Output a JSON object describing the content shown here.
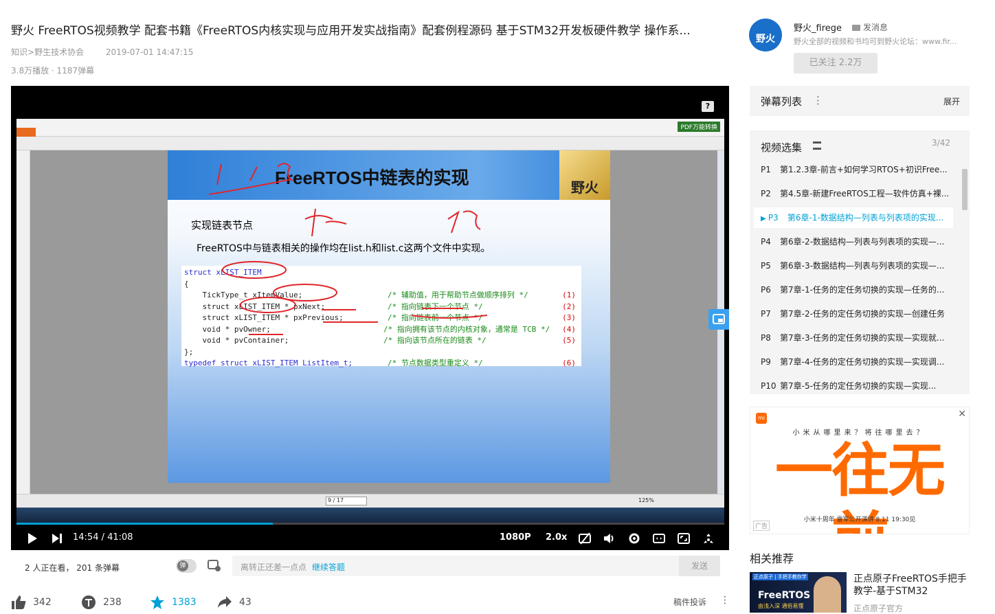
{
  "video": {
    "title": "野火 FreeRTOS视频教学 配套书籍《FreeRTOS内核实现与应用开发实战指南》配套例程源码 基于STM32开发板硬件教学 操作系...",
    "breadcrumb_1": "知识",
    "breadcrumb_sep": ">",
    "breadcrumb_2": "野生技术协会",
    "date": "2019-07-01 14:47:15",
    "stats": "3.8万播放 · 1187弹幕"
  },
  "player": {
    "time": "14:54 / 41:08",
    "quality": "1080P",
    "speed": "2.0x",
    "progress": 0.362,
    "watching": "2 人正在看， 201 条弹幕",
    "danmaku_placeholder": "离转正还差一点点",
    "danmaku_link": "继续答题",
    "send_label": "发送",
    "danmaku_knob": "弹"
  },
  "slide": {
    "title": "FreeRTOS中链表的实现",
    "logo": "野火",
    "heading": "实现链表节点",
    "desc": "FreeRTOS中与链表相关的操作均在list.h和list.c这两个文件中实现。",
    "code_lines": [
      {
        "text": "struct xLIST_ITEM",
        "comment": "",
        "num": ""
      },
      {
        "text": "{",
        "comment": "",
        "num": ""
      },
      {
        "text": "    TickType_t xItemValue;",
        "comment": "/* 辅助值，用于帮助节点做顺序排列 */",
        "num": "(1)"
      },
      {
        "text": "    struct xLIST_ITEM * pxNext;",
        "comment": "/* 指向链表下一个节点 */",
        "num": "(2)"
      },
      {
        "text": "    struct xLIST_ITEM * pxPrevious;",
        "comment": "/* 指向链表前一个节点 */",
        "num": "(3)"
      },
      {
        "text": "    void * pvOwner;",
        "comment": "/* 指向拥有该节点的内核对象，通常是 TCB */",
        "num": "(4)"
      },
      {
        "text": "    void * pvContainer;",
        "comment": "/* 指向该节点所在的链表 */",
        "num": "(5)"
      },
      {
        "text": "};",
        "comment": "",
        "num": ""
      },
      {
        "text": "typedef struct xLIST_ITEM ListItem_t;",
        "comment": "/* 节点数据类型重定义 */",
        "num": "(6)"
      }
    ],
    "pdf_button": "PDF万能转换",
    "page_indicator": "9 / 17",
    "zoom": "125%"
  },
  "uploader": {
    "name": "野火_firege",
    "message": "发消息",
    "desc": "野火全部的视频和书均可到野火论坛：www.fir...",
    "follow": "已关注 2.2万",
    "avatar_text": "野火"
  },
  "danmaku_list": {
    "title": "弹幕列表",
    "expand": "展开"
  },
  "playlist": {
    "title": "视频选集",
    "count": "3/42",
    "items": [
      {
        "p": "P1",
        "label": "第1.2.3章-前言+如何学习RTOS+初识Free..."
      },
      {
        "p": "P2",
        "label": "第4.5章-新建FreeRTOS工程—软件仿真+裸..."
      },
      {
        "p": "P3",
        "label": "第6章-1-数据结构—列表与列表项的实现..."
      },
      {
        "p": "P4",
        "label": "第6章-2-数据结构—列表与列表项的实现—..."
      },
      {
        "p": "P5",
        "label": "第6章-3-数据结构—列表与列表项的实现—..."
      },
      {
        "p": "P6",
        "label": "第7章-1-任务的定任务切换的实现—任务的..."
      },
      {
        "p": "P7",
        "label": "第7章-2-任务的定任务切换的实现—创建任务"
      },
      {
        "p": "P8",
        "label": "第7章-3-任务的定任务切换的实现—实现就..."
      },
      {
        "p": "P9",
        "label": "第7章-4-任务的定任务切换的实现—实现调..."
      },
      {
        "p": "P10",
        "label": "第7章-5-任务的定任务切换的实现—实现..."
      }
    ]
  },
  "ad": {
    "brand": "mi",
    "sub": "小米从哪里来？将往哪里去？",
    "big": "一往无前",
    "foot": "小米十周年  雷军公开演讲 8.11 19:30见",
    "tag": "广告"
  },
  "actions": {
    "like": "342",
    "coin": "238",
    "fav": "1383",
    "share": "43",
    "report": "稿件投诉"
  },
  "recommend": {
    "title": "相关推荐",
    "video_title": "正点原子FreeRTOS手把手教学-基于STM32",
    "up": "正点原子官方",
    "thumb_tag": "正点原子 | 手把手教你学",
    "thumb_title": "FreeRTOS",
    "thumb_sub": "由浅入深 通俗易懂"
  },
  "colors": {
    "accent": "#00a1d6",
    "ad_orange": "#ff6a00"
  }
}
